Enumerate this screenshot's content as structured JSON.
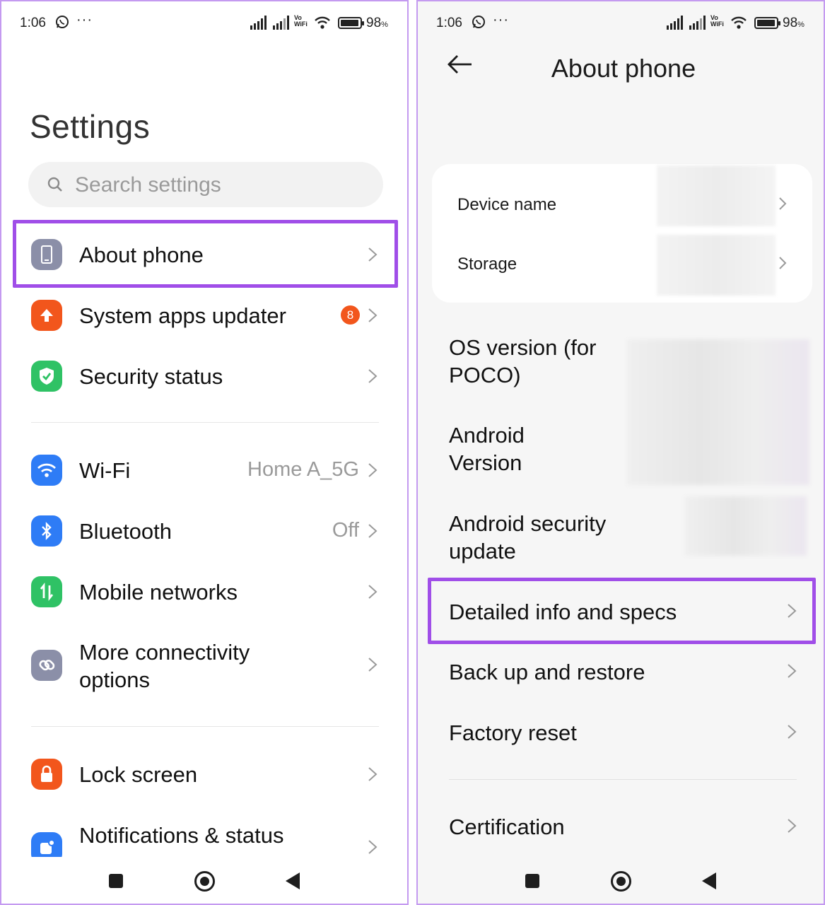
{
  "status_bar": {
    "time": "1:06",
    "network_label_top": "Vo",
    "network_label_bottom": "WiFi",
    "battery": "98",
    "battery_unit": "%",
    "battery_level": 0.98
  },
  "left": {
    "title": "Settings",
    "search": {
      "placeholder": "Search settings"
    },
    "items": [
      {
        "label": "About phone",
        "icon": "phone-icon",
        "color": "#8b8fa8"
      },
      {
        "label": "System apps updater",
        "icon": "arrow-up-icon",
        "color": "#f2561c",
        "badge": "8"
      },
      {
        "label": "Security status",
        "icon": "shield-check-icon",
        "color": "#2fc265"
      },
      {
        "label": "Wi-Fi",
        "icon": "wifi-icon",
        "color": "#2e7cf6",
        "value": "Home A_5G"
      },
      {
        "label": "Bluetooth",
        "icon": "bluetooth-icon",
        "color": "#2e7cf6",
        "value": "Off"
      },
      {
        "label": "Mobile networks",
        "icon": "mobile-data-icon",
        "color": "#2fc265"
      },
      {
        "label": "More connectivity",
        "label2": "options",
        "icon": "link-icon",
        "color": "#8b8fa8"
      },
      {
        "label": "Lock screen",
        "icon": "lock-icon",
        "color": "#f2561c"
      },
      {
        "label": "Notifications & status",
        "icon": "notification-icon",
        "color": "#2e7cf6"
      }
    ]
  },
  "right": {
    "title": "About phone",
    "card": [
      {
        "label": "Device name"
      },
      {
        "label": "Storage"
      }
    ],
    "info": [
      {
        "line1": "OS version (for",
        "line2": "POCO)"
      },
      {
        "line1": "Android",
        "line2": "Version"
      },
      {
        "line1": "Android security",
        "line2": "update"
      }
    ],
    "items": [
      {
        "label": "Detailed info and specs"
      },
      {
        "label": "Back up and restore"
      },
      {
        "label": "Factory reset"
      },
      {
        "label": "Certification"
      }
    ]
  },
  "highlight_color": "#a04ee8"
}
